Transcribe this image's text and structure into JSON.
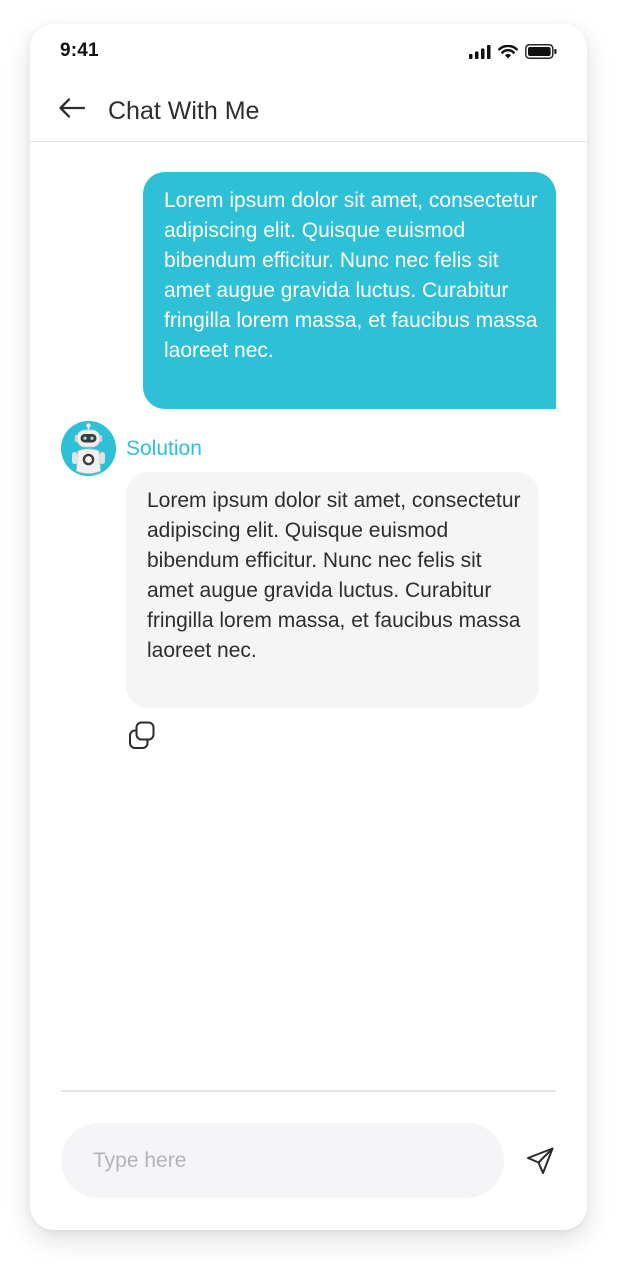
{
  "status_bar": {
    "time": "9:41",
    "icons": [
      "cellular-signal-icon",
      "wifi-icon",
      "battery-icon"
    ]
  },
  "header": {
    "back_icon": "arrow-left-icon",
    "title": "Chat With Me"
  },
  "messages": [
    {
      "sender": "user",
      "text": "Lorem ipsum dolor sit amet, consectetur adipiscing elit. Quisque euismod bibendum efficitur. Nunc nec felis sit amet augue gravida luctus. Curabitur fringilla lorem massa, et faucibus massa laoreet nec."
    },
    {
      "sender": "bot",
      "name": "Solution",
      "text": "Lorem ipsum dolor sit amet, consectetur adipiscing elit. Quisque euismod bibendum efficitur. Nunc nec felis sit amet augue gravida luctus. Curabitur fringilla lorem massa, et faucibus massa laoreet nec.",
      "action_icon": "copy-icon"
    }
  ],
  "composer": {
    "placeholder": "Type here",
    "value": "",
    "send_icon": "send-icon"
  },
  "colors": {
    "accent": "#2ec0d6",
    "bot_bubble": "#f5f5f5",
    "text": "#2e2e2e",
    "placeholder": "#b4b4b8"
  }
}
